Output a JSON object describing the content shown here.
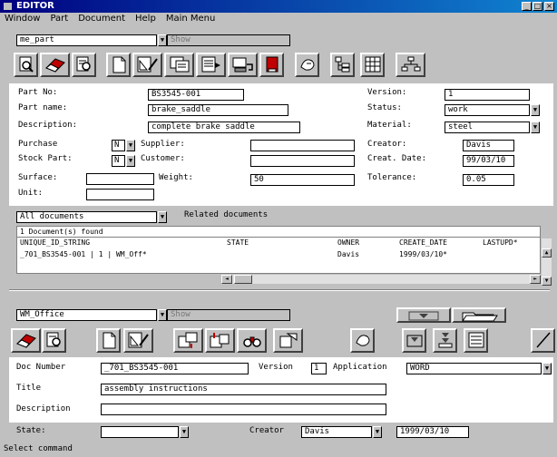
{
  "window": {
    "title": "EDITOR",
    "minimize": "_",
    "maximize": "□",
    "close": "×"
  },
  "menu": {
    "items": [
      "Window",
      "Part",
      "Document",
      "Help",
      "Main Menu"
    ]
  },
  "top_select": {
    "value": "me_part",
    "show": "Show"
  },
  "part": {
    "part_no_label": "Part No:",
    "part_no": "BS3545-001",
    "version_label": "Version:",
    "version": "1",
    "part_name_label": "Part name:",
    "part_name": "brake_saddle",
    "status_label": "Status:",
    "status": "work",
    "description_label": "Description:",
    "description": "complete brake saddle",
    "material_label": "Material:",
    "material": "steel",
    "purchase_label": "Purchase",
    "purchase": "N",
    "supplier_label": "Supplier:",
    "supplier": "",
    "creator_label": "Creator:",
    "creator": "Davis",
    "stock_label": "Stock Part:",
    "stock": "N",
    "customer_label": "Customer:",
    "customer": "",
    "creat_date_label": "Creat. Date:",
    "creat_date": "99/03/10",
    "surface_label": "Surface:",
    "surface": "",
    "weight_label": "Weight:",
    "weight": "50",
    "tolerance_label": "Tolerance:",
    "tolerance": "0.05",
    "unit_label": "Unit:",
    "unit": ""
  },
  "documents": {
    "filter": "All documents",
    "related_label": "Related documents",
    "found": "1 Document(s) found",
    "columns": [
      "UNIQUE_ID_STRING",
      "STATE",
      "OWNER",
      "CREATE_DATE",
      "LASTUPD*"
    ],
    "rows": [
      [
        "_701_BS3545-001 | 1 | WM_Off*",
        "",
        "Davis",
        "1999/03/10*",
        ""
      ]
    ]
  },
  "office_select": {
    "value": "WM_Office",
    "show": "Show"
  },
  "doc": {
    "number_label": "Doc Number",
    "number": "_701_BS3545-001",
    "version_label": "Version",
    "version": "1",
    "application_label": "Application",
    "application": "WORD",
    "title_label": "Title",
    "title": "assembly instructions",
    "description_label": "Description",
    "description": "",
    "state_label": "State:",
    "state": "",
    "creator_label": "Creator",
    "creator": "Davis",
    "date": "1999/03/10"
  },
  "status_bar": "Select command"
}
